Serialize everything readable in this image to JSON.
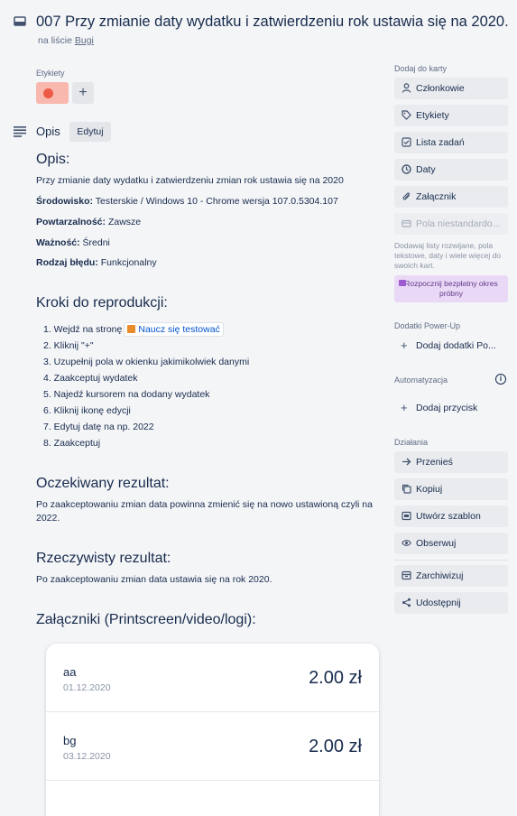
{
  "card": {
    "title": "007 Przy zmianie daty wydatku i zatwierdzeniu rok ustawia się na 2020.",
    "list_prefix": "na liście ",
    "list_name": "Bugi"
  },
  "labels": {
    "heading": "Etykiety",
    "add_symbol": "+",
    "colors": {
      "label": "#eb5a46",
      "label_bg": "#f8b8ae"
    }
  },
  "description": {
    "title": "Opis",
    "edit_label": "Edytuj",
    "heading_opis": "Opis:",
    "summary": "Przy zmianie daty wydatku i zatwierdzeniu zmian rok ustawia się na 2020",
    "env_label": "Środowisko:",
    "env_value": " Testerskie / Windows 10 - Chrome wersja 107.0.5304.107",
    "repeat_label": "Powtarzalność:",
    "repeat_value": " Zawsze",
    "severity_label": "Ważność:",
    "severity_value": " Średni",
    "type_label": "Rodzaj błędu:",
    "type_value": " Funkcjonalny",
    "steps_heading": "Kroki do reprodukcji:",
    "step1_prefix": "1. Wejdź na stronę",
    "step1_link": "Naucz się testować",
    "steps": [
      "2. Kliknij \"+\"",
      "3. Uzupełnij pola w okienku jakimikolwiek danymi",
      "4. Zaakceptuj wydatek",
      "5. Najedź kursorem na dodany wydatek",
      "6. Kliknij ikonę edycji",
      "7. Edytuj datę na np. 2022",
      "8. Zaakceptuj"
    ],
    "expected_heading": "Oczekiwany rezultat:",
    "expected_text": "Po zaakceptowaniu zmian data powinna zmienić się na nowo ustawioną czyli na 2022.",
    "actual_heading": "Rzeczywisty rezultat:",
    "actual_text": "Po zaakceptowaniu zmian data ustawia się na rok 2020.",
    "attachments_heading": "Załączniki (Printscreen/video/logi):"
  },
  "attachment": {
    "rows": [
      {
        "name": "aa",
        "date": "01.12.2020",
        "amount": "2.00 zł"
      },
      {
        "name": "bg",
        "date": "03.12.2020",
        "amount": "2.00 zł"
      }
    ]
  },
  "sidebar": {
    "add_heading": "Dodaj do karty",
    "members": "Członkowie",
    "labels": "Etykiety",
    "checklist": "Lista zadań",
    "dates": "Daty",
    "attachment": "Załącznik",
    "custom_fields": "Pola niestandardo...",
    "note": "Dodawaj listy rozwijane, pola tekstowe, daty i wiele więcej do swoich kart.",
    "trial": "Rozpocznij bezpłatny okres próbny",
    "powerups_heading": "Dodatki Power-Up",
    "add_powerups": "Dodaj dodatki Po...",
    "automation_heading": "Automatyzacja",
    "add_button": "Dodaj przycisk",
    "actions_heading": "Działania",
    "move": "Przenieś",
    "copy": "Kopiuj",
    "template": "Utwórz szablon",
    "watch": "Obserwuj",
    "archive": "Zarchiwizuj",
    "share": "Udostępnij"
  }
}
